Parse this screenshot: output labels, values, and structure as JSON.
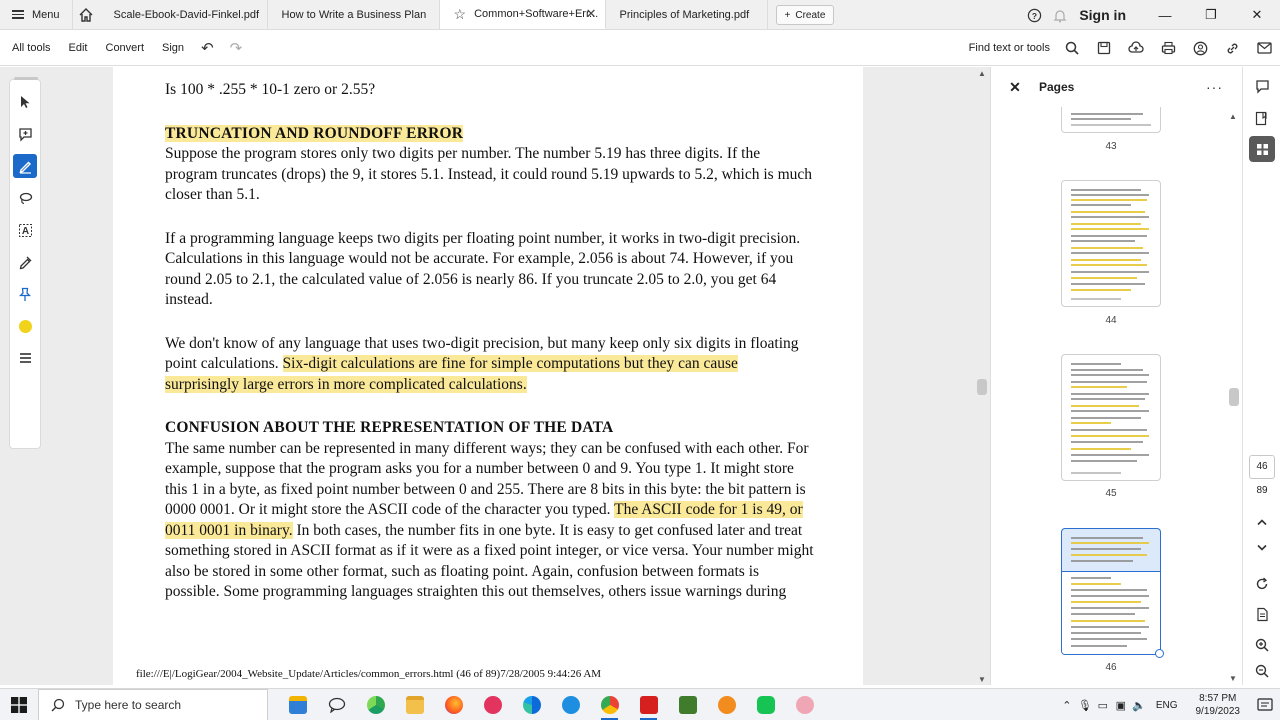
{
  "tabbar": {
    "menu_label": "Menu",
    "tabs": [
      {
        "label": "Scale-Ebook-David-Finkel.pdf"
      },
      {
        "label": "How to Write a Business Plan"
      },
      {
        "label": "Common+Software+Err..."
      },
      {
        "label": "Principles of Marketing.pdf"
      }
    ],
    "create_label": "Create",
    "signin_label": "Sign in"
  },
  "toolbar": {
    "items": [
      "All tools",
      "Edit",
      "Convert",
      "Sign"
    ],
    "find_label": "Find text or tools"
  },
  "document": {
    "intro_line": "Is 100 * .255 * 10-1 zero or 2.55?",
    "heading1": "TRUNCATION AND ROUNDOFF ERROR",
    "para1": "Suppose the program stores only two digits per number. The number 5.19 has three digits. If the program truncates (drops) the 9, it stores 5.1. Instead, it could round 5.19 upwards to 5.2, which is much closer than 5.1.",
    "para2": "If a programming language keeps two digits per floating point number, it works in two-digit precision. Calculations in this language would not be accurate. For example, 2.056 is about 74. However, if you round 2.05 to 2.1, the calculated value of 2.056 is nearly 86. If you truncate 2.05 to 2.0, you get 64 instead.",
    "para3_plain": "We don't know of any language that uses two-digit precision, but many keep only six digits in floating point calculations. ",
    "para3_highlight": "Six-digit calculations are fine for simple computations but they can cause surprisingly large errors in more complicated calculations.",
    "heading2": "CONFUSION ABOUT THE REPRESENTATION OF THE DATA",
    "para4_a": "The same number can be represented in many different ways; they can be confused with each other. For example, suppose that the program asks you for a number between 0 and 9. You type 1. It might store this 1 in a byte, as fixed point number between 0 and 255. There are 8 bits in this byte: the bit pattern is 0000 0001. Or it might store the ASCII code of the character you typed. ",
    "para4_highlight": "The ASCII code for 1 is 49, or 0011 0001 in binary.",
    "para4_b": " In both cases, the number fits in one byte. It is easy to get confused later and treat something stored in ASCII format as if it were as a fixed point integer, or vice versa. Your number might also be stored in some other format, such as floating point. Again, confusion between formats is possible. Some programming languages straighten this out themselves, others issue warnings during",
    "footer": "file:///E|/LogiGear/2004_Website_Update/Articles/common_errors.html (46 of 89)7/28/2005 9:44:26 AM"
  },
  "pages_panel": {
    "title": "Pages",
    "thumbnails": [
      {
        "page": "43"
      },
      {
        "page": "44"
      },
      {
        "page": "45"
      },
      {
        "page": "46",
        "selected": true
      }
    ]
  },
  "page_nav": {
    "current": "46",
    "total": "89"
  },
  "taskbar": {
    "search_placeholder": "Type here to search",
    "lang": "ENG",
    "time": "8:57 PM",
    "date": "9/19/2023"
  },
  "colors": {
    "highlight": "#fbe99a",
    "accent": "#1b6ac9",
    "annotation_yellow": "#f0d31a"
  }
}
